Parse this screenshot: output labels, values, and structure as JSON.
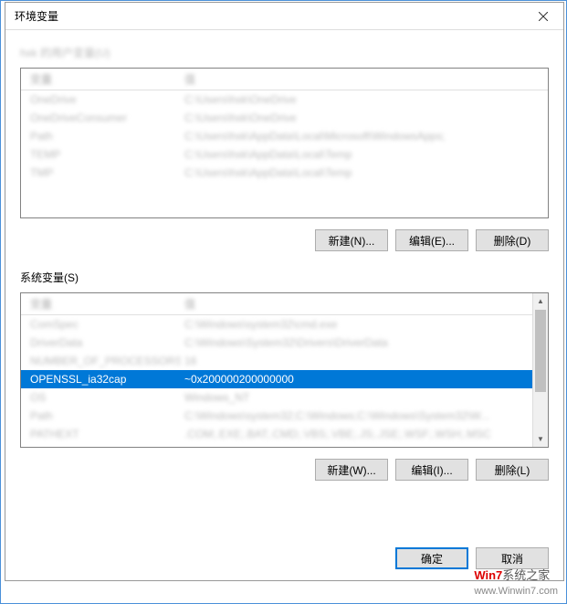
{
  "dialog": {
    "title": "环境变量",
    "close_icon": "×"
  },
  "user_section": {
    "label_blurred": "hxk 的用户变量(U)",
    "header_col1": "变量",
    "header_col2": "值",
    "rows": [
      {
        "name": "OneDrive",
        "value": "C:\\Users\\hxk\\OneDrive"
      },
      {
        "name": "OneDriveConsumer",
        "value": "C:\\Users\\hxk\\OneDrive"
      },
      {
        "name": "Path",
        "value": "C:\\Users\\hxk\\AppData\\Local\\Microsoft\\WindowsApps;"
      },
      {
        "name": "TEMP",
        "value": "C:\\Users\\hxk\\AppData\\Local\\Temp"
      },
      {
        "name": "TMP",
        "value": "C:\\Users\\hxk\\AppData\\Local\\Temp"
      }
    ],
    "buttons": {
      "new": "新建(N)...",
      "edit": "编辑(E)...",
      "delete": "删除(D)"
    }
  },
  "system_section": {
    "label": "系统变量(S)",
    "header_col1": "变量",
    "header_col2": "值",
    "rows_before": [
      {
        "name": "ComSpec",
        "value": "C:\\Windows\\system32\\cmd.exe"
      },
      {
        "name": "DriverData",
        "value": "C:\\Windows\\System32\\Drivers\\DriverData"
      },
      {
        "name": "NUMBER_OF_PROCESSORS",
        "value": "16"
      }
    ],
    "selected_row": {
      "name": "OPENSSL_ia32cap",
      "value": "~0x200000200000000"
    },
    "rows_after": [
      {
        "name": "OS",
        "value": "Windows_NT"
      },
      {
        "name": "Path",
        "value": "C:\\Windows\\system32;C:\\Windows;C:\\Windows\\System32\\W..."
      },
      {
        "name": "PATHEXT",
        "value": ".COM;.EXE;.BAT;.CMD;.VBS;.VBE;.JS;.JSE;.WSF;.WSH;.MSC"
      }
    ],
    "buttons": {
      "new": "新建(W)...",
      "edit": "编辑(I)...",
      "delete": "删除(L)"
    }
  },
  "bottom_buttons": {
    "ok": "确定",
    "cancel": "取消"
  },
  "watermark": {
    "text1": "Win7",
    "text2": "系统之家",
    "url": "www.Winwin7.com"
  }
}
